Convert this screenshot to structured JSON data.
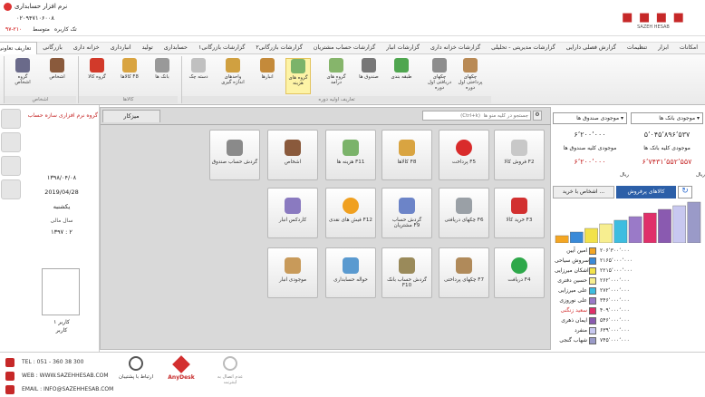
{
  "window": {
    "title": "نرم افزار حسابداری",
    "phone": "۰۲۰۹۴۷۱۰۶۰۰۸",
    "user": "تک کاربره",
    "version": "متوسط",
    "code": "۹۷-۲۱۰",
    "brand": "SAZEH HESAB"
  },
  "menu": [
    "امکانات",
    "ابزار",
    "تنظیمات",
    "گزارش فصلی دارایی",
    "گزارشات مدیریتی - تحلیلی",
    "گزارشات خزانه داری",
    "گزارشات انبار",
    "گزارشات حساب مشتریان",
    "گزارشات بازرگانی۲",
    "گزارشات بازرگانی۱",
    "حسابداری",
    "تولید",
    "انبارداری",
    "خزانه داری",
    "بازرگانی",
    "تعاریف تعاونی"
  ],
  "ribbon": {
    "g1": {
      "label": "تعاریف اولیه دوره",
      "buttons": [
        "چکهای پرداختی اول دوره",
        "چکهای دریافتی اول دوره",
        "طبقه بندی",
        "صندوق ها",
        "گروه های درآمد",
        "گروه های هزینه",
        "انبارها",
        "واحدهای اندازه گیری",
        "دسته چک"
      ]
    },
    "g2": {
      "label": "کالاها",
      "buttons": [
        "بانک ها",
        "کالاها F8",
        "گروه کالا"
      ]
    },
    "g3": {
      "label": "اشخاص",
      "buttons": [
        "اشخاص",
        "گروه اشخاص"
      ]
    }
  },
  "left": {
    "company": "گروه نرم افزاری سازه حساب",
    "date_fa": "۱۳۹۸/۰۴/۰۸",
    "date_en": "2019/04/28",
    "weekday": "یکشنبه",
    "fy_label": "سال مالی",
    "fy": "۱۳۹۷ : ۲",
    "user_label": "کاربر ۱",
    "user_name": "کاربر"
  },
  "tabs": {
    "desk": "میزکار",
    "search_ph": "جستجو در کلیه منو ها  (Ctrl+k)"
  },
  "tiles": [
    {
      "label": "فروش کالا F2",
      "color": "#c8c8c8"
    },
    {
      "label": "پرداخت F5",
      "color": "#d92b2b"
    },
    {
      "label": "کالاها F8",
      "color": "#d9a441"
    },
    {
      "label": "هزینه ها F11",
      "color": "#7bb36a"
    },
    {
      "label": "اشخاص",
      "color": "#8a5a3c"
    },
    {
      "label": "گردش حساب صندوق",
      "color": "#8a8a8a"
    },
    {
      "label": "خرید کالا F3",
      "color": "#d23030"
    },
    {
      "label": "چکهای دریافتی F6",
      "color": "#9aa0a6"
    },
    {
      "label": "گردش حساب مشتریان F9",
      "color": "#6c84c8"
    },
    {
      "label": "فیش های نقدی F12",
      "color": "#f0a020"
    },
    {
      "label": "کاردکس انبار",
      "color": "#8a7ac0"
    },
    {
      "label": "دریافت F4",
      "color": "#2ea84a"
    },
    {
      "label": "چکهای پرداختی F7",
      "color": "#b08a5a"
    },
    {
      "label": "گردش حساب بانک F10",
      "color": "#9a8a5a"
    },
    {
      "label": "حواله حسابداری",
      "color": "#5a9ad0"
    },
    {
      "label": "موجودی انبار",
      "color": "#c89a5a"
    }
  ],
  "right": {
    "bank_label": "موجودی بانک ها",
    "cash_label": "موجودی صندوق ها",
    "bank_value": "۵٬۰۴۵٬۸۹۶٬۵۳۷",
    "cash_value": "۶٬۲۰۰٬۰۰۰",
    "bank_all_label": "موجودی کلیه بانک ها",
    "cash_all_label": "موجودی کلیه صندوق ها",
    "bank_all_value": "۶٬۷۴۳۱٬۵۵۲٬۵۵۷",
    "cash_all_value": "۶٬۲۰۰٬۰۰۰",
    "currency": "ریال",
    "tab1": "کالاهای پرفروش",
    "tab2": "اشخاص با خرید ...",
    "items": [
      {
        "name": "امین آیین",
        "value": "۲۰۶٬۳۰۰٬۰۰۰",
        "color": "#f4a623"
      },
      {
        "name": "سروش سیاحی",
        "value": "۲۱۶۵٬۰۰۰٬۰۰۰",
        "color": "#3a8ad8"
      },
      {
        "name": "اشکان میرزایی",
        "value": "۲۲۱۵٬۰۰۰٬۰۰۰",
        "color": "#f2e24a"
      },
      {
        "name": "حسین دفتری",
        "value": "۲۶۲٬۰۰۰٬۰۰۰",
        "color": "#f7ee90"
      },
      {
        "name": "علی میرزایی",
        "value": "۲۷۲٬۰۰۰٬۰۰۰",
        "color": "#3dbde0"
      },
      {
        "name": "علی نوروزی",
        "value": "۳۴۶٬۰۰۰٬۰۰۰",
        "color": "#9a7ac8"
      },
      {
        "name": "سعید زنگنی",
        "value": "۴۰۹٬۰۰۰٬۰۰۰",
        "color": "#e0306a"
      },
      {
        "name": "ایمان ذهری",
        "value": "۵۴۶٬۰۰۰٬۰۰۰",
        "color": "#8a5ab0"
      },
      {
        "name": "منفرد",
        "value": "۶۳۹٬۰۰۰٬۰۰۰",
        "color": "#c8c8f0"
      },
      {
        "name": "شهاب گنجی",
        "value": "۷۴۵٬۰۰۰٬۰۰۰",
        "color": "#9a9ac8"
      }
    ]
  },
  "footer": {
    "tel": "TEL : 051 - 360 38 300",
    "web": "WEB : WWW.SAZEHHESAB.COM",
    "email": "EMAIL : INFO@SAZEHHESAB.COM",
    "support": "ارتباط با پشتیبان",
    "anydesk": "AnyDesk",
    "internet": "عدم اتصال به اینترنت"
  }
}
